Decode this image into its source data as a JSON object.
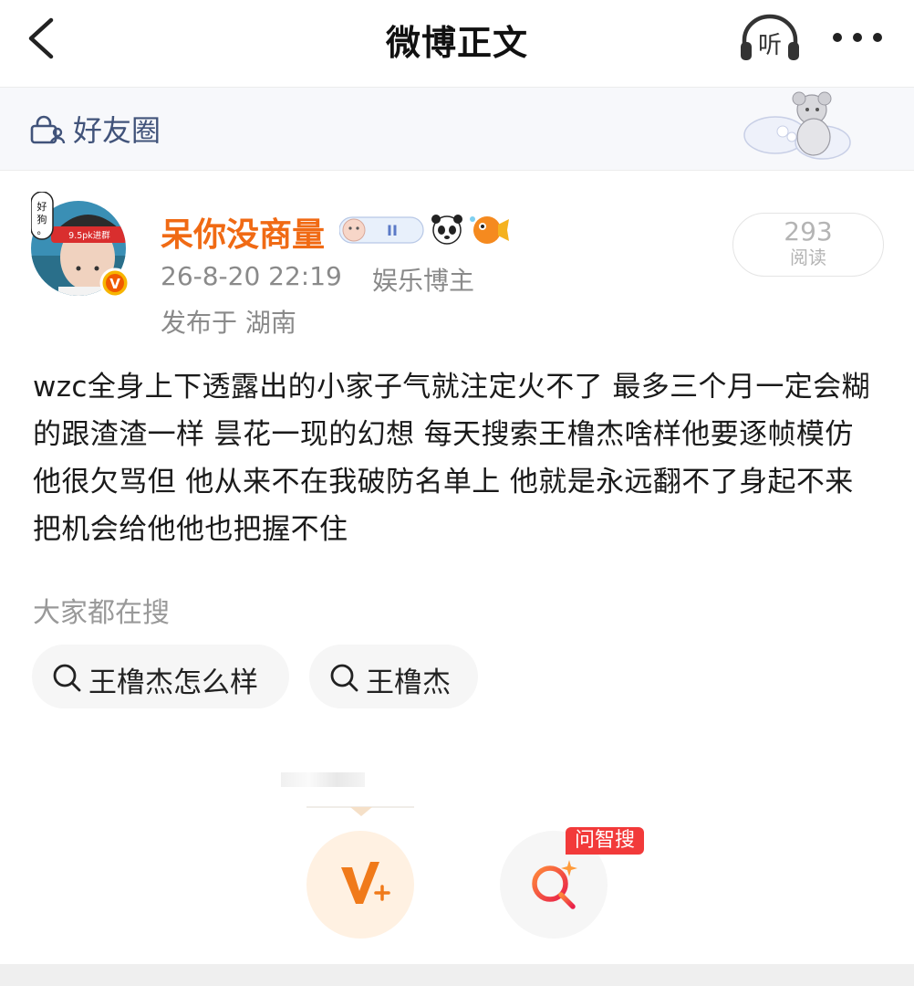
{
  "nav": {
    "title": "微博正文",
    "back_icon": "chevron-left-icon",
    "listen_label": "听",
    "more_icon": "ellipsis-icon"
  },
  "friends_bar": {
    "label": "好友圈",
    "icon": "lock-people-icon"
  },
  "post": {
    "username": "呆你没商量",
    "avatar_text": "好狗。",
    "avatar_band": "9.5pk进群",
    "time": "26-8-20 22:19",
    "role": "娱乐博主",
    "location": "发布于 湖南",
    "reads": {
      "count": "293",
      "label": "阅读"
    },
    "content": "wzc全身上下透露出的小家子气就注定火不了 最多三个月一定会糊的跟渣渣一样 昙花一现的幻想 每天搜索王橹杰啥样他要逐帧模仿 他很欠骂但 他从来不在我破防名单上 他就是永远翻不了身起不来 把机会给他他也把握不住"
  },
  "search": {
    "title": "大家都在搜",
    "chips": [
      {
        "label": "王橹杰怎么样"
      },
      {
        "label": "王橹杰"
      }
    ]
  },
  "floating": {
    "ai_search_tag": "问智搜"
  },
  "colors": {
    "username": "#f06a14",
    "link_blue": "#41537a",
    "tag_red": "#f23a3a",
    "gray_text": "#8a8a8a"
  }
}
